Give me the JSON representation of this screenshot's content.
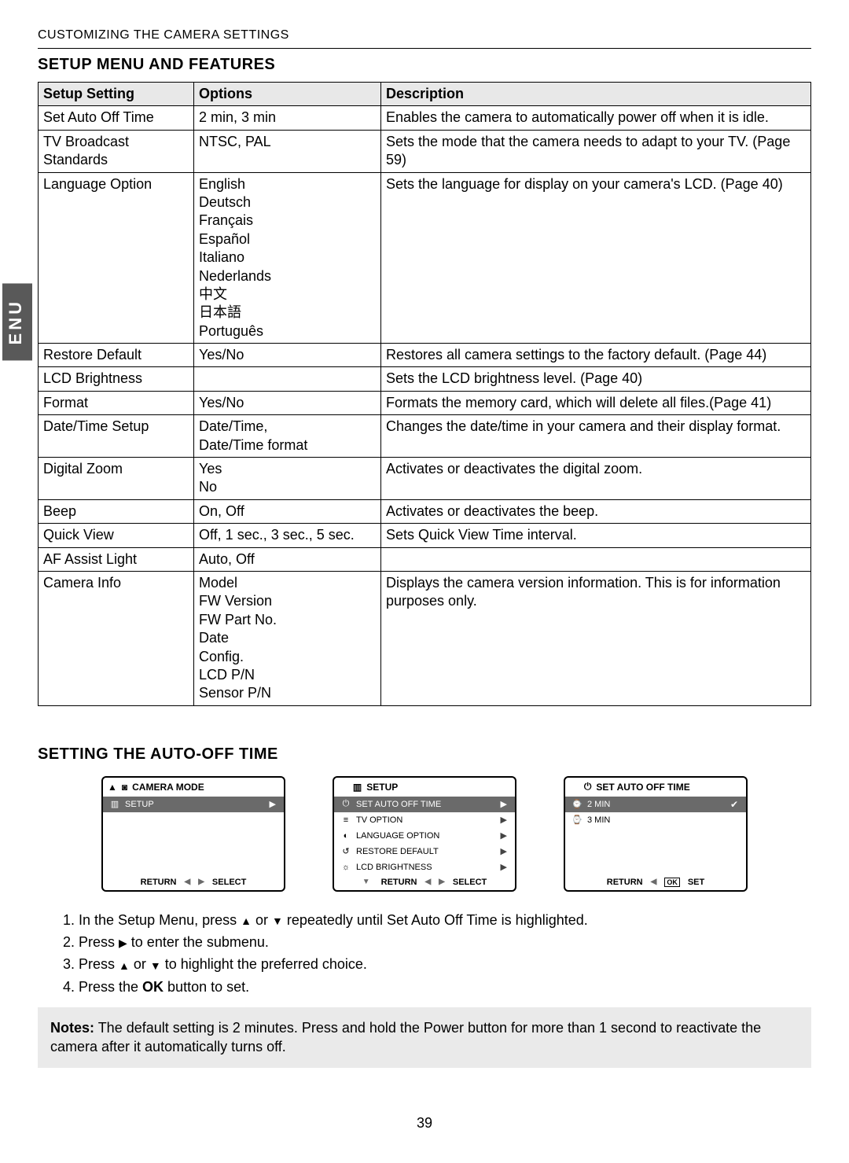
{
  "breadcrumb": "CUSTOMIZING THE CAMERA SETTINGS",
  "side_tab": "ENU",
  "section_title": "SETUP MENU AND FEATURES",
  "table": {
    "headers": [
      "Setup Setting",
      "Options",
      "Description"
    ],
    "rows": [
      {
        "setting": "Set Auto Off Time",
        "options": "2 min, 3 min",
        "desc": "Enables the camera to automatically power off when it is idle."
      },
      {
        "setting": "TV Broadcast Standards",
        "options": "NTSC, PAL",
        "desc": "Sets the mode that the camera needs to adapt to your TV. (Page 59)"
      },
      {
        "setting": "Language Option",
        "options": "English\nDeutsch\nFrançais\nEspañol\nItaliano\nNederlands\n中文\n日本語\nPortuguês",
        "desc": "Sets the language for display on your camera's LCD. (Page 40)"
      },
      {
        "setting": "Restore Default",
        "options": "Yes/No",
        "desc": "Restores all camera settings to the factory default. (Page 44)"
      },
      {
        "setting": "LCD Brightness",
        "options": "",
        "desc": "Sets the LCD brightness level. (Page 40)"
      },
      {
        "setting": "Format",
        "options": "Yes/No",
        "desc": "Formats the memory card, which will delete all files.(Page 41)"
      },
      {
        "setting": "Date/Time Setup",
        "options": "Date/Time,\nDate/Time format",
        "desc": "Changes the date/time in your camera and their display format."
      },
      {
        "setting": "Digital Zoom",
        "options": "Yes\nNo",
        "desc": "Activates or deactivates the digital zoom."
      },
      {
        "setting": "Beep",
        "options": "On, Off",
        "desc": "Activates or deactivates the beep."
      },
      {
        "setting": "Quick View",
        "options": "Off, 1 sec., 3 sec., 5 sec.",
        "desc": "Sets Quick View Time interval."
      },
      {
        "setting": "AF Assist Light",
        "options": "Auto, Off",
        "desc": ""
      },
      {
        "setting": "Camera Info",
        "options": "Model\nFW Version\nFW Part No.\nDate\nConfig.\nLCD P/N\nSensor P/N",
        "desc": "Displays the camera version information. This is for information purposes only."
      }
    ]
  },
  "sub_section_title": "SETTING THE AUTO-OFF TIME",
  "screens": {
    "s1": {
      "head_label": "CAMERA MODE",
      "row1": "SETUP",
      "foot_left": "RETURN",
      "foot_right": "SELECT"
    },
    "s2": {
      "head_label": "SETUP",
      "items": [
        {
          "label": "SET AUTO OFF TIME",
          "sel": true
        },
        {
          "label": "TV OPTION",
          "sel": false
        },
        {
          "label": "LANGUAGE OPTION",
          "sel": false
        },
        {
          "label": "RESTORE DEFAULT",
          "sel": false
        },
        {
          "label": "LCD BRIGHTNESS",
          "sel": false
        }
      ],
      "foot_left": "RETURN",
      "foot_right": "SELECT"
    },
    "s3": {
      "head_label": "SET AUTO OFF TIME",
      "items": [
        {
          "label": "2 MIN",
          "sel": true,
          "check": true
        },
        {
          "label": "3 MIN",
          "sel": false
        }
      ],
      "foot_left": "RETURN",
      "foot_right": "SET",
      "ok": "OK"
    }
  },
  "steps": {
    "s1a": "In the Setup Menu, press ",
    "s1b": " or ",
    "s1c": " repeatedly until Set Auto Off Time is highlighted.",
    "s2a": "Press ",
    "s2b": " to enter the submenu.",
    "s3a": "Press ",
    "s3b": " or ",
    "s3c": " to highlight the preferred choice.",
    "s4a": "Press the ",
    "s4b": "OK",
    "s4c": " button to set."
  },
  "notes_label": "Notes:",
  "notes_text": " The default setting is 2 minutes. Press and hold the Power button for more than 1 second to reactivate the camera after it automatically turns off.",
  "page_number": "39"
}
